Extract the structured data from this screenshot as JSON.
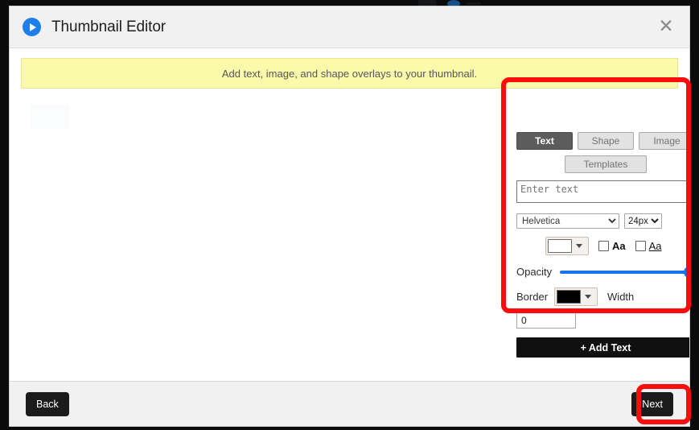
{
  "window": {
    "title": "Thumbnail Editor",
    "logo_icon": "play-circle-icon",
    "close_icon": "close-icon"
  },
  "banner": {
    "message": "Add text, image, and shape overlays to your thumbnail."
  },
  "panel": {
    "tabs": [
      {
        "label": "Text",
        "active": true
      },
      {
        "label": "Shape",
        "active": false
      },
      {
        "label": "Image",
        "active": false
      }
    ],
    "templates_tab": {
      "label": "Templates",
      "active": false
    },
    "text_input": {
      "value": "",
      "placeholder": "Enter text"
    },
    "font": {
      "selected": "Helvetica",
      "options": [
        "Helvetica"
      ]
    },
    "font_size": {
      "selected": "24px",
      "options": [
        "24px"
      ]
    },
    "fill_color": {
      "label": "fill-color",
      "value": "#ffffff",
      "caret_icon": "chevron-down-icon"
    },
    "bold_checkbox": {
      "label": "Aa",
      "checked": false
    },
    "underline_checkbox": {
      "label": "Aa",
      "checked": false
    },
    "opacity": {
      "label": "Opacity",
      "value": 100,
      "min": 0,
      "max": 100,
      "color": "#1a73e8"
    },
    "border": {
      "label": "Border",
      "color_value": "#000000",
      "caret_icon": "chevron-down-icon",
      "width_label": "Width",
      "width_value": "0"
    },
    "add_button": {
      "label": "+ Add Text"
    }
  },
  "footer": {
    "back_label": "Back",
    "next_label": "Next"
  },
  "annotations": {
    "highlight_color": "#fb0d0d",
    "regions": [
      "overlay-options-panel",
      "next-button"
    ]
  }
}
